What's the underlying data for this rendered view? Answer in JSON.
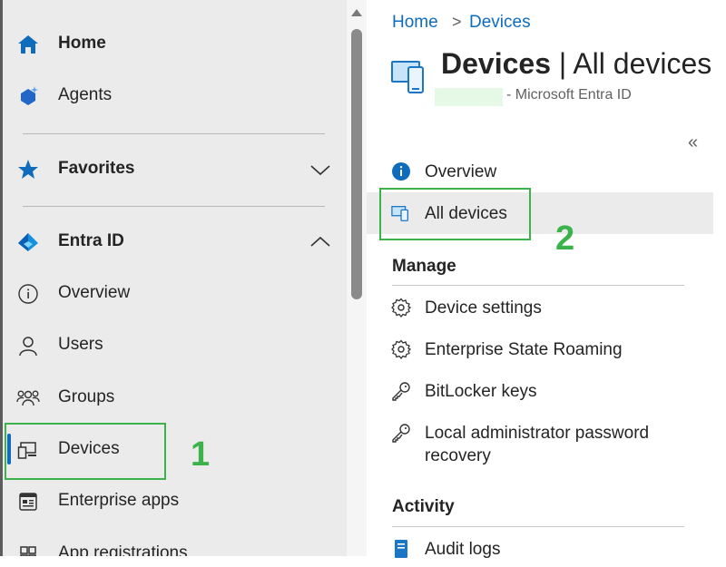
{
  "sidebar": {
    "items": [
      {
        "label": "Home",
        "icon": "home-icon"
      },
      {
        "label": "Agents",
        "icon": "agents-icon"
      },
      {
        "label": "Favorites",
        "icon": "star-icon"
      },
      {
        "label": "Entra ID",
        "icon": "entra-id-icon"
      },
      {
        "label": "Overview",
        "icon": "info-icon"
      },
      {
        "label": "Users",
        "icon": "user-icon"
      },
      {
        "label": "Groups",
        "icon": "groups-icon"
      },
      {
        "label": "Devices",
        "icon": "devices-icon",
        "selected": true
      },
      {
        "label": "Enterprise apps",
        "icon": "enterprise-apps-icon"
      },
      {
        "label": "App registrations",
        "icon": "app-registrations-icon"
      }
    ]
  },
  "annotations": {
    "one": "1",
    "two": "2",
    "color": "#3cb34a"
  },
  "breadcrumb": {
    "home": "Home",
    "separator": ">",
    "current": "Devices"
  },
  "header": {
    "title_main": "Devices",
    "title_rest": " | All devices",
    "subtitle": "- Microsoft Entra ID",
    "collapse": "«"
  },
  "menu": {
    "overview": "Overview",
    "all_devices": "All devices",
    "manage_heading": "Manage",
    "device_settings": "Device settings",
    "enterprise_state_roaming": "Enterprise State Roaming",
    "bitlocker_keys": "BitLocker keys",
    "laps_line1": "Local administrator password",
    "laps_line2": "recovery",
    "activity_heading": "Activity",
    "audit_logs": "Audit logs"
  },
  "colors": {
    "accent": "#0f6cbd",
    "highlight": "#3cb34a",
    "sidebar_bg": "#ebebeb"
  }
}
